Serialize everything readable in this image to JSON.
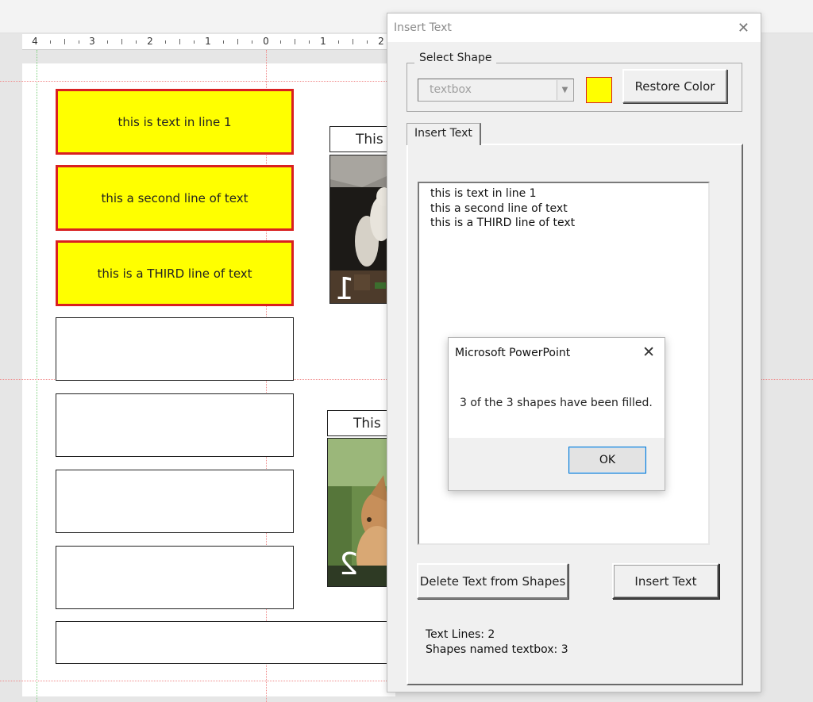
{
  "ruler": {
    "labels": [
      "4",
      "3",
      "2",
      "1",
      "0",
      "1",
      "2"
    ]
  },
  "slide": {
    "filled_shapes": [
      "this is text in line 1",
      "this a second line of text",
      "this is a THIRD line of text"
    ],
    "colors": {
      "fill": "#ffff00",
      "border": "#d92020"
    },
    "title_box_1": "This",
    "title_box_2": "This",
    "photo_1_number": "1",
    "photo_2_number": "2"
  },
  "dialog": {
    "title": "Insert Text",
    "close_icon": "close-icon",
    "group_label": "Select Shape",
    "shape_combo_value": "textbox",
    "color_swatch": "#ffff00",
    "restore_color_label": "Restore Color",
    "tab_label": "Insert Text",
    "text_lines": [
      "this is text in line 1",
      "this a second line of text",
      "this is a THIRD line of text"
    ],
    "delete_button_label": "Delete Text from Shapes",
    "insert_button_label": "Insert Text",
    "status_text_lines": "Text Lines: 2",
    "status_shapes_named": "Shapes named textbox: 3"
  },
  "message_box": {
    "title": "Microsoft PowerPoint",
    "message": "3 of the 3 shapes have been filled.",
    "ok_label": "OK"
  }
}
